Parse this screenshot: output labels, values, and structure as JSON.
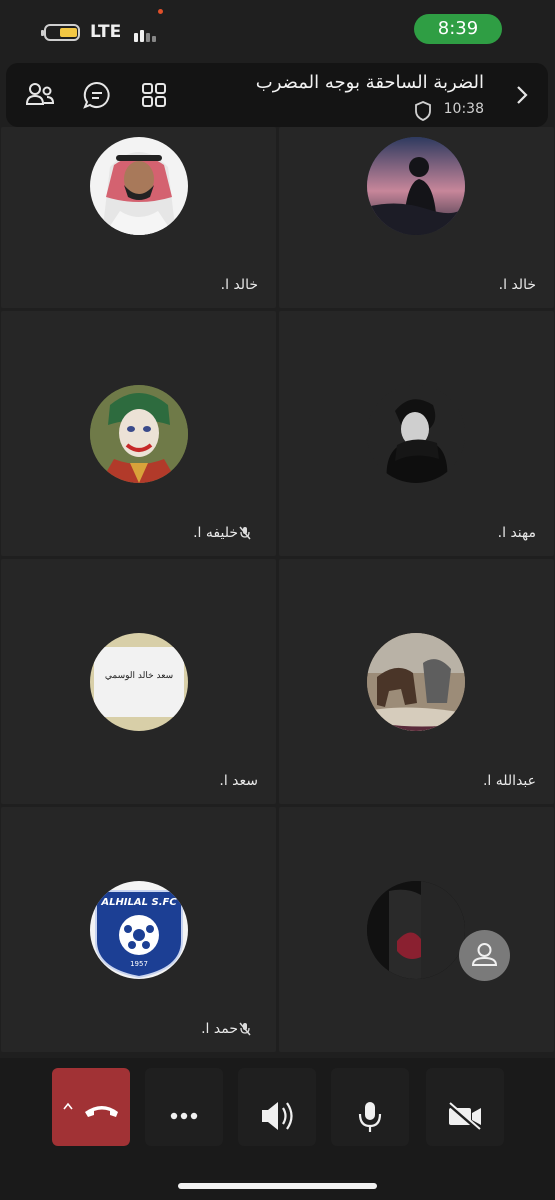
{
  "status_bar": {
    "network": "LTE",
    "time": "8:39",
    "colors": {
      "battery": "#f2c744",
      "time_pill": "#2f9e44"
    }
  },
  "header": {
    "meeting_title": "الضربة الساحقة بوجه المضرب",
    "elapsed": "10:38",
    "icons": [
      "people-icon",
      "chat-icon",
      "grid-view-icon",
      "shield-icon",
      "chevron-right-icon"
    ]
  },
  "participants": [
    {
      "name": "خالد ا.",
      "muted": false,
      "avatar": "profile-photo"
    },
    {
      "name": "خالد ا.",
      "muted": false,
      "avatar": "sunset-silhouette"
    },
    {
      "name": "خليفه ا.",
      "muted": true,
      "avatar": "joker"
    },
    {
      "name": "مهند ا.",
      "muted": false,
      "avatar": "hooded-person"
    },
    {
      "name": "سعد ا.",
      "muted": false,
      "avatar": "name-card",
      "avatar_text": "سعد خالد الوسمي"
    },
    {
      "name": "عبدالله ا.",
      "muted": false,
      "avatar": "horse-landscape"
    },
    {
      "name": "حمد ا.",
      "muted": true,
      "avatar": "alhilal-logo",
      "logo_text": "ALHILAL S.FC",
      "logo_year": "1957"
    },
    {
      "name": "",
      "muted": false,
      "avatar": "partial-image"
    }
  ],
  "controls": {
    "items": [
      "end-call-button",
      "more-options-button",
      "speaker-button",
      "microphone-button",
      "camera-off-button"
    ],
    "colors": {
      "end_call": "#a13235"
    }
  }
}
